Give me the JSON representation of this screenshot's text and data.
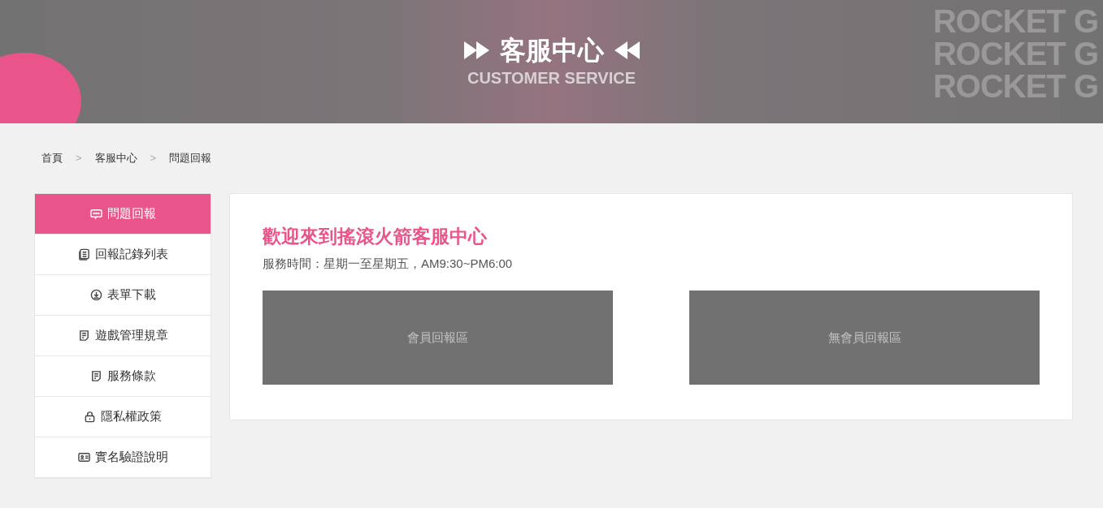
{
  "banner": {
    "title": "客服中心",
    "subtitle": "CUSTOMER SERVICE",
    "backdrop_words": [
      "ROCKET G",
      "ROCKET G",
      "ROCKET G"
    ]
  },
  "breadcrumb": [
    {
      "label": "首頁"
    },
    {
      "label": ">"
    },
    {
      "label": "客服中心"
    },
    {
      "label": ">"
    },
    {
      "label": "問題回報"
    }
  ],
  "sidebar": {
    "items": [
      {
        "label": "問題回報",
        "kind": "chat",
        "selected": true
      },
      {
        "label": "回報記錄列表",
        "kind": "stack",
        "selected": false
      },
      {
        "label": "表單下載",
        "kind": "download",
        "selected": false
      },
      {
        "label": "遊戲管理規章",
        "kind": "document",
        "selected": false
      },
      {
        "label": "服務條款",
        "kind": "document",
        "selected": false
      },
      {
        "label": "隱私權政策",
        "kind": "lock",
        "selected": false
      },
      {
        "label": "實名驗證說明",
        "kind": "idcard",
        "selected": false
      }
    ]
  },
  "main": {
    "heading": "歡迎來到搖滾火箭客服中心",
    "hours": "服務時間：星期一至星期五，AM9:30~PM6:00",
    "panels": [
      {
        "label": "會員回報區"
      },
      {
        "label": "無會員回報區"
      }
    ]
  }
}
